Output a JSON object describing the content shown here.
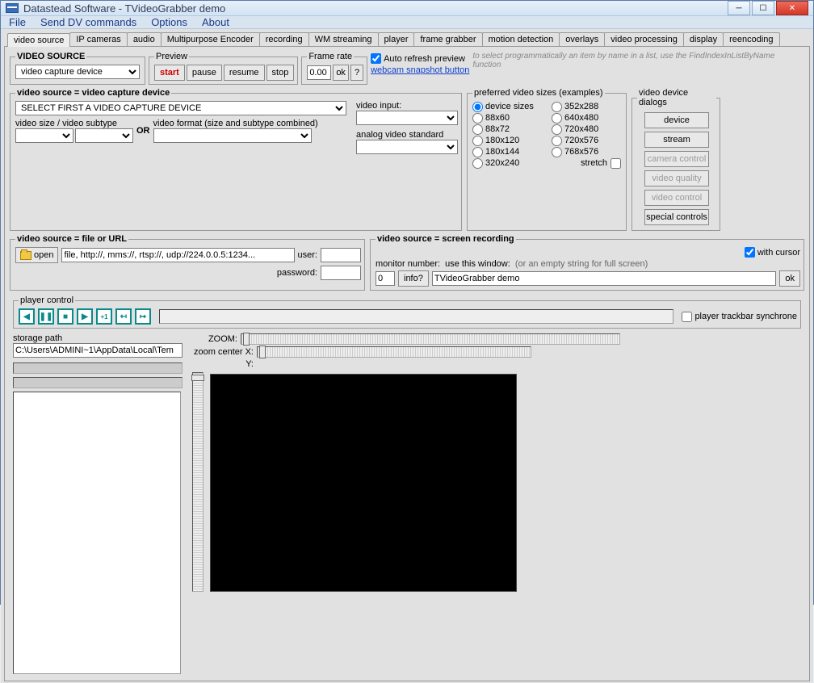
{
  "window": {
    "title": "Datastead Software - TVideoGrabber demo"
  },
  "menu": {
    "file": "File",
    "senddv": "Send DV commands",
    "options": "Options",
    "about": "About"
  },
  "tabs": {
    "video_source": "video source",
    "ip_cameras": "IP cameras",
    "audio": "audio",
    "multi_enc": "Multipurpose Encoder",
    "recording": "recording",
    "wm": "WM streaming",
    "player": "player",
    "frame_grab": "frame grabber",
    "motion": "motion detection",
    "overlays": "overlays",
    "vproc": "video processing",
    "display": "display",
    "reenc": "reencoding"
  },
  "hint": "to select programmatically an item by name in a list, use the FindIndexInListByName function",
  "src": {
    "legend": "VIDEO SOURCE",
    "combo": "video capture device"
  },
  "preview": {
    "legend": "Preview",
    "start": "start",
    "pause": "pause",
    "resume": "resume",
    "stop": "stop"
  },
  "framerate": {
    "legend": "Frame rate",
    "value": "0.00",
    "ok": "ok",
    "q": "?"
  },
  "auto_refresh": "Auto refresh preview",
  "webcam_link": "webcam snapshot button",
  "vsrc_dev": {
    "heading": "video source = video capture device",
    "select_text": "SELECT FIRST A VIDEO CAPTURE DEVICE",
    "size_label": "video size / video subtype",
    "or": "OR",
    "format_label": "video format (size and subtype combined)"
  },
  "vinput": {
    "label": "video input:",
    "analog_label": "analog video standard"
  },
  "sizes": {
    "legend": "preferred video sizes (examples)",
    "device_sizes": "device sizes",
    "s352": "352x288",
    "s88x60": "88x60",
    "s640": "640x480",
    "s88x72": "88x72",
    "s720x480": "720x480",
    "s180x120": "180x120",
    "s720x576": "720x576",
    "s180x144": "180x144",
    "s768": "768x576",
    "s320": "320x240",
    "stretch": "stretch"
  },
  "dialogs": {
    "legend": "video device dialogs",
    "device": "device",
    "stream": "stream",
    "camera": "camera control",
    "quality": "video quality",
    "vcontrol": "video control",
    "special": "special controls"
  },
  "file_src": {
    "legend": "video source = file or URL",
    "open": "open",
    "placeholder": "file, http://, mms://, rtsp://, udp://224.0.0.5:1234...",
    "user": "user:",
    "password": "password:"
  },
  "screen_rec": {
    "heading": "video source = screen recording",
    "with_cursor": "with cursor",
    "monitor": "monitor number:",
    "monitor_val": "0",
    "info": "info?",
    "use_window": "use this window:",
    "hint": "(or an empty string for full screen)",
    "window_val": "TVideoGrabber demo",
    "ok": "ok"
  },
  "player": {
    "legend": "player control",
    "sync": "player trackbar synchrone"
  },
  "storage": {
    "label": "storage path",
    "value": "C:\\Users\\ADMINI~1\\AppData\\Local\\Tem"
  },
  "zoom": {
    "label": "ZOOM:",
    "xc": "zoom center X:",
    "yc": "Y:"
  }
}
